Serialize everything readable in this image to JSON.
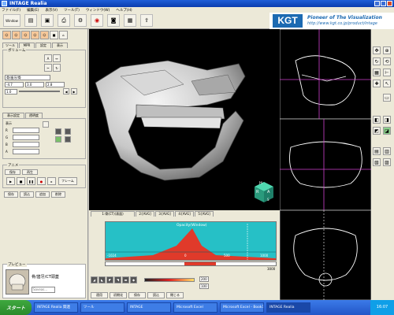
{
  "window": {
    "title": "INTAGE Realia"
  },
  "menu": [
    "ファイル(F)",
    "編集(E)",
    "表示(V)",
    "ツール(T)",
    "ウィンドウ(W)",
    "ヘルプ(H)"
  ],
  "toolbar": {
    "first_label": "Window"
  },
  "logo": {
    "text": "KGT",
    "slogan": "Pioneer of The Visualization",
    "url": "http://www.kgt.co.jp/product/intage"
  },
  "left": {
    "tabs": [
      "ツール",
      "MPR",
      "設定",
      "表示"
    ],
    "section_label": "ボリューム",
    "field1": "骨/歯牙/骨",
    "fields": [
      "-4.7",
      "3.0",
      "2.8",
      "1.0"
    ],
    "render_group": "表示設定",
    "render_tab2": "透明度",
    "check_label": "表示",
    "rows": [
      "R",
      "G",
      "B",
      "A"
    ],
    "animation_group": "アニメ",
    "anim_buttons": [
      "保存",
      "再生"
    ],
    "anim_button": "フレーム",
    "anim_bottom": [
      "保存",
      "読込",
      "追加",
      "削除"
    ],
    "preview_group": "プレビュー",
    "preview_text": "骨/歯牙/CT頭蓋",
    "preview_input": "Saveas..."
  },
  "lower": {
    "tabs": [
      "1:骨(CT)(表面)",
      "2:[AVG]",
      "3:[AVG]",
      "4:[AVG]",
      "5:[AVG]"
    ],
    "histogram_label": "Opacity(Window)",
    "ticks": [
      "-1024",
      "0",
      "500",
      "1000"
    ],
    "range_right": "3000",
    "spin_values": [
      "200",
      "100"
    ],
    "footer_buttons": [
      "適用",
      "初期化",
      "保存",
      "読込",
      "閉じる"
    ]
  },
  "orient": {
    "A": "A",
    "R": "R",
    "H": "H",
    "S": "S"
  },
  "taskbar": {
    "start": "スタート",
    "tasks": [
      "INTAGE Realia 関連",
      "ツール",
      "INTAGE",
      "Microsoft Excel",
      "Microsoft Excel - Book1",
      "INTAGE Realia"
    ],
    "clock": "16:07"
  },
  "colors": {
    "accent": "#1c6ab2",
    "histogram": "#26c0c6",
    "peak": "#e03a2a"
  }
}
